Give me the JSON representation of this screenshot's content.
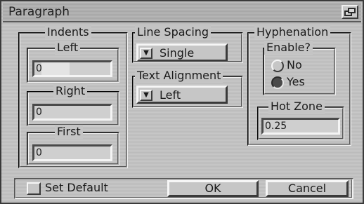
{
  "window": {
    "title": "Paragraph",
    "restore_icon": "restore-window-icon"
  },
  "indents": {
    "title": "Indents",
    "left": {
      "label": "Left",
      "value": "0"
    },
    "right": {
      "label": "Right",
      "value": "0"
    },
    "first": {
      "label": "First",
      "value": "0"
    }
  },
  "line_spacing": {
    "title": "Line Spacing",
    "selected": "Single",
    "arrow_icon": "down-arrow-icon"
  },
  "text_alignment": {
    "title": "Text Alignment",
    "selected": "Left",
    "arrow_icon": "down-arrow-icon"
  },
  "hyphenation": {
    "title": "Hyphenation",
    "enable": {
      "title": "Enable?",
      "options": [
        {
          "label": "No",
          "checked": false
        },
        {
          "label": "Yes",
          "checked": true
        }
      ]
    },
    "hot_zone": {
      "title": "Hot Zone",
      "value": "0.25"
    }
  },
  "footer": {
    "set_default_label": "Set Default",
    "set_default_checked": false,
    "ok_label": "OK",
    "cancel_label": "Cancel"
  }
}
